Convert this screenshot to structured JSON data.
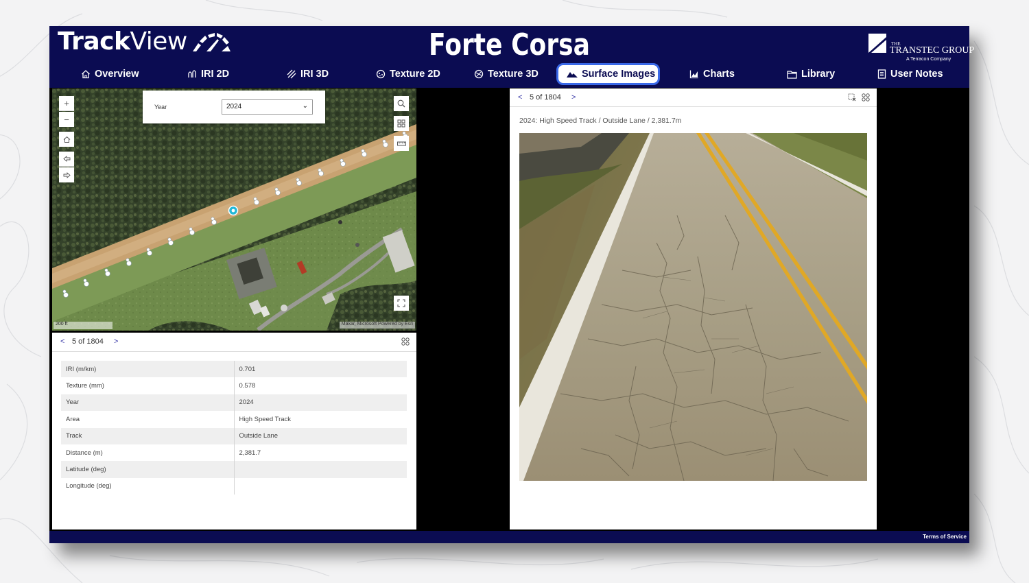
{
  "brand": {
    "name_bold": "Track",
    "name_light": "View"
  },
  "app_title": "Forte Corsa",
  "company": {
    "pre": "THE",
    "name": "TRANSTEC GROUP",
    "sub": "A Terracon Company"
  },
  "nav": [
    {
      "label": "Overview",
      "icon": "home-icon"
    },
    {
      "label": "IRI 2D",
      "icon": "iri-2d-icon"
    },
    {
      "label": "IRI 3D",
      "icon": "iri-3d-icon"
    },
    {
      "label": "Texture 2D",
      "icon": "texture-2d-icon"
    },
    {
      "label": "Texture 3D",
      "icon": "texture-3d-icon"
    },
    {
      "label": "Surface Images",
      "icon": "mountain-icon",
      "active": true
    },
    {
      "label": "Charts",
      "icon": "chart-icon"
    },
    {
      "label": "Library",
      "icon": "folder-icon"
    },
    {
      "label": "User Notes",
      "icon": "notes-icon"
    }
  ],
  "map": {
    "year_label": "Year",
    "year_value": "2024",
    "zoom_in": "+",
    "zoom_out": "−",
    "scale": "200 ft",
    "attribution": "Maxar, Microsoft   Powered by Esri"
  },
  "attributes": {
    "pager": {
      "prev": "<",
      "count": "5 of 1804",
      "next": ">"
    },
    "rows": [
      {
        "label": "IRI (m/km)",
        "value": "0.701"
      },
      {
        "label": "Texture (mm)",
        "value": "0.578"
      },
      {
        "label": "Year",
        "value": "2024"
      },
      {
        "label": "Area",
        "value": "High Speed Track"
      },
      {
        "label": "Track",
        "value": "Outside Lane"
      },
      {
        "label": "Distance (m)",
        "value": "2,381.7"
      },
      {
        "label": "Latitude (deg)",
        "value": ""
      },
      {
        "label": "Longitude (deg)",
        "value": ""
      }
    ]
  },
  "image_viewer": {
    "pager": {
      "prev": "<",
      "count": "5 of 1804",
      "next": ">"
    },
    "caption": "2024: High Speed Track / Outside Lane / 2,381.7m"
  },
  "footer": {
    "terms": "Terms of Service"
  },
  "colors": {
    "header": "#0b0c52",
    "active_border": "#3a69e8",
    "track_marker": "#22b8d8",
    "lane_yellow": "#e0a826"
  }
}
